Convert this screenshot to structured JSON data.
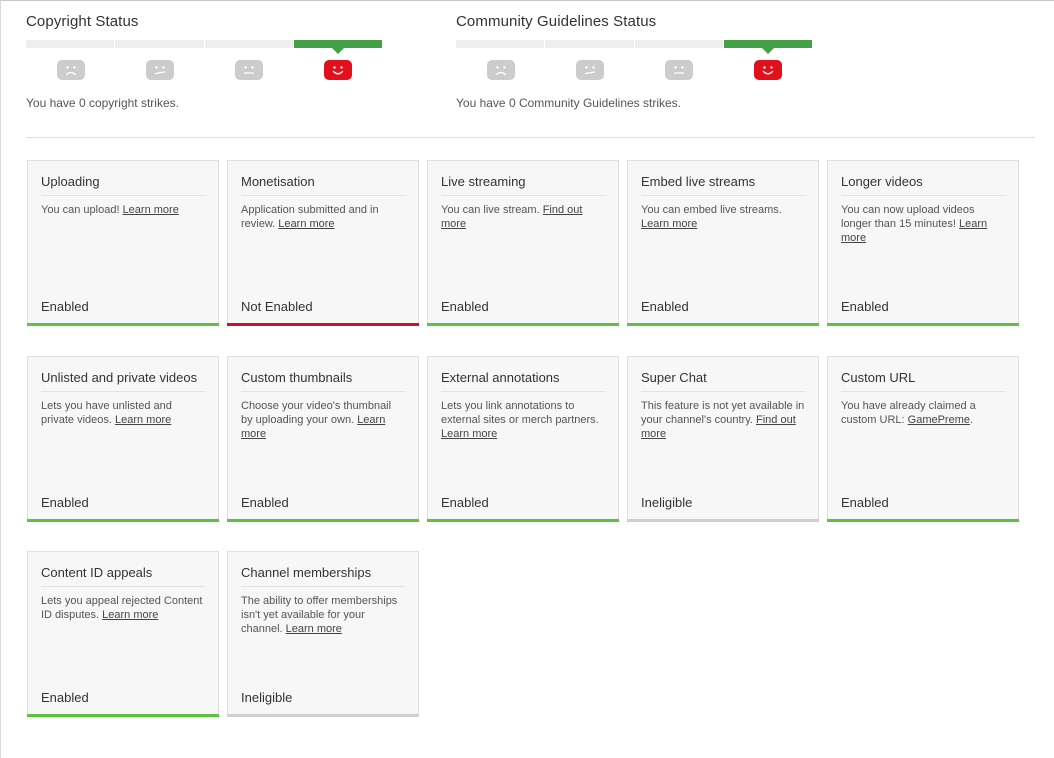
{
  "colors": {
    "enabled": "#5ac43e",
    "not_enabled": "#cc1032",
    "ineligible": "#cfcfcf",
    "strike_active": "#43a047",
    "happy_face": "#e0111d",
    "face_inactive": "#cccccc"
  },
  "copyright": {
    "title": "Copyright Status",
    "strike_text": "You have 0 copyright strikes.",
    "active_segment": 4,
    "faces": [
      "sad-face-icon",
      "meh-face-icon",
      "neutral-face-icon",
      "happy-face-icon"
    ]
  },
  "community": {
    "title": "Community Guidelines Status",
    "strike_text": "You have 0 Community Guidelines strikes.",
    "active_segment": 4,
    "faces": [
      "sad-face-icon",
      "meh-face-icon",
      "neutral-face-icon",
      "happy-face-icon"
    ]
  },
  "features": [
    {
      "id": "uploading",
      "title": "Uploading",
      "desc": "You can upload! ",
      "link": "Learn more",
      "status": "Enabled",
      "state": "enabled"
    },
    {
      "id": "monetisation",
      "title": "Monetisation",
      "desc": "Application submitted and in review. ",
      "link": "Learn more",
      "status": "Not Enabled",
      "state": "not-enabled"
    },
    {
      "id": "live-streaming",
      "title": "Live streaming",
      "desc": "You can live stream. ",
      "link": "Find out more",
      "status": "Enabled",
      "state": "enabled"
    },
    {
      "id": "embed-live-streams",
      "title": "Embed live streams",
      "desc": "You can embed live streams. ",
      "link": "Learn more",
      "status": "Enabled",
      "state": "enabled"
    },
    {
      "id": "longer-videos",
      "title": "Longer videos",
      "desc": "You can now upload videos longer than 15 minutes! ",
      "link": "Learn more",
      "status": "Enabled",
      "state": "enabled"
    },
    {
      "id": "unlisted-private",
      "title": "Unlisted and private videos",
      "desc": "Lets you have unlisted and private videos. ",
      "link": "Learn more",
      "status": "Enabled",
      "state": "enabled"
    },
    {
      "id": "custom-thumbnails",
      "title": "Custom thumbnails",
      "desc": "Choose your video's thumbnail by uploading your own. ",
      "link": "Learn more",
      "status": "Enabled",
      "state": "enabled"
    },
    {
      "id": "external-annotations",
      "title": "External annotations",
      "desc": "Lets you link annotations to external sites or merch partners. ",
      "link": "Learn more",
      "status": "Enabled",
      "state": "enabled"
    },
    {
      "id": "super-chat",
      "title": "Super Chat",
      "desc": "This feature is not yet available in your channel's country. ",
      "link": "Find out more",
      "status": "Ineligible",
      "state": "ineligible"
    },
    {
      "id": "custom-url",
      "title": "Custom URL",
      "desc": "You have already claimed a custom URL: ",
      "link": "GamePreme",
      "suffix": ".",
      "status": "Enabled",
      "state": "enabled"
    },
    {
      "id": "content-id-appeals",
      "title": "Content ID appeals",
      "desc": "Lets you appeal rejected Content ID disputes. ",
      "link": "Learn more",
      "status": "Enabled",
      "state": "enabled"
    },
    {
      "id": "channel-memberships",
      "title": "Channel memberships",
      "desc": "The ability to offer memberships isn't yet available for your channel. ",
      "link": "Learn more",
      "status": "Ineligible",
      "state": "ineligible"
    }
  ]
}
